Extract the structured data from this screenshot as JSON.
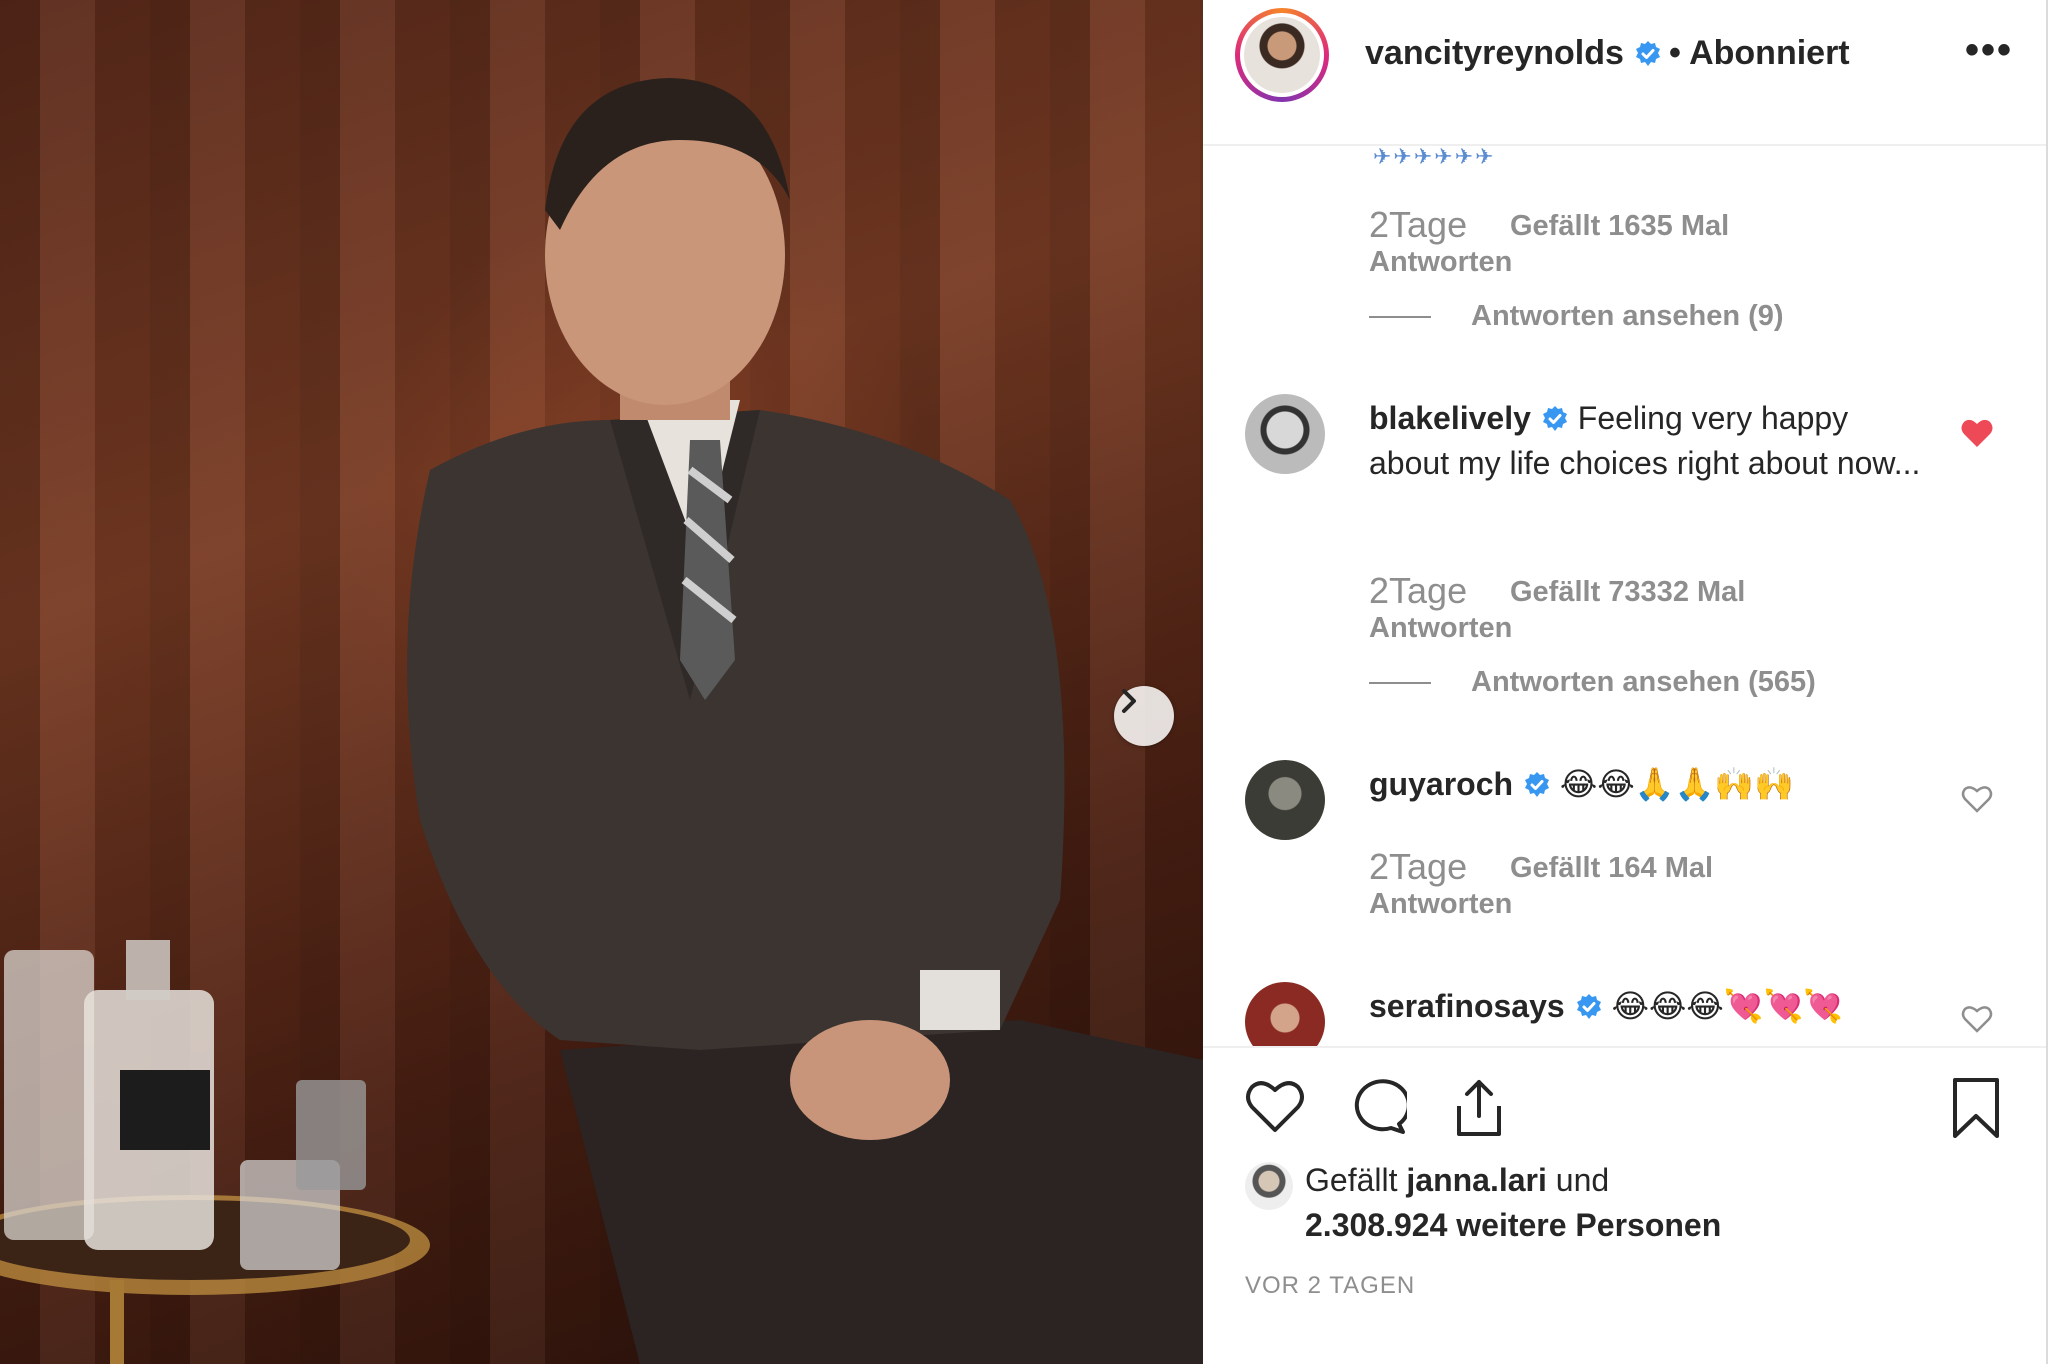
{
  "post": {
    "username": "vancityreynolds",
    "follow_status": "• Abonniert",
    "more_label": "•••"
  },
  "comments": {
    "partial_top": {
      "emoji_fragment": "✈✈✈✈✈✈",
      "time": "2Tage",
      "likes": "Gefällt 1635 Mal",
      "reply": "Antworten",
      "view_replies": "Antworten ansehen (9)"
    },
    "items": [
      {
        "username": "blakelively",
        "text": "Feeling very happy about my life choices right about now...",
        "time": "2Tage",
        "likes": "Gefällt 73332 Mal",
        "reply": "Antworten",
        "view_replies": "Antworten ansehen (565)",
        "liked": true
      },
      {
        "username": "guyaroch",
        "text": "😂😂🙏🙏🙌🙌",
        "time": "2Tage",
        "likes": "Gefällt 164 Mal",
        "reply": "Antworten",
        "liked": false
      },
      {
        "username": "serafinosays",
        "text": "😂😂😂💘💘💘",
        "liked": false
      }
    ]
  },
  "likes_summary": {
    "prefix": "Gefällt",
    "user": "janna.lari",
    "conj": "und",
    "count": "2.308.924 weitere Personen"
  },
  "time_ago": "VOR 2 TAGEN",
  "colors": {
    "verified": "#3897f0",
    "liked_heart": "#ed4956",
    "muted_text": "#8e8e8e"
  }
}
